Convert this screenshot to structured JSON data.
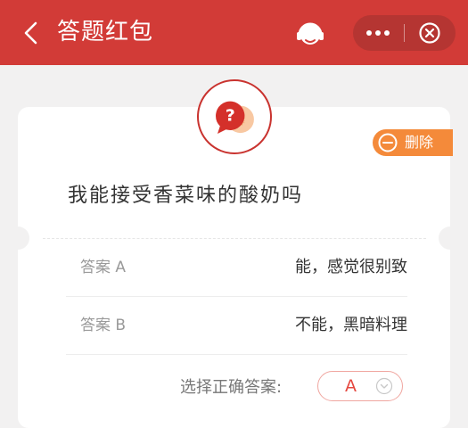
{
  "header": {
    "title": "答题红包",
    "icons": [
      "back-icon",
      "customer-service-icon",
      "more-icon",
      "close-icon"
    ]
  },
  "card": {
    "badge_icon": "red-envelope-question-icon",
    "delete_label": "删除",
    "question": "我能接受香菜味的酸奶吗",
    "answers": [
      {
        "label": "答案 A",
        "value": "能，感觉很别致"
      },
      {
        "label": "答案 B",
        "value": "不能，黑暗料理"
      }
    ],
    "select": {
      "label": "选择正确答案:",
      "value": "A"
    }
  },
  "colors": {
    "header_bg": "#d23b37",
    "accent_orange": "#f48a3a",
    "accent_red": "#e5483f"
  }
}
